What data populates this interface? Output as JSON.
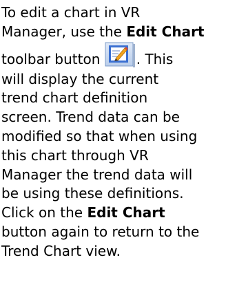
{
  "lines": [
    {
      "text": "To edit a chart in VR"
    },
    {
      "text": "Manager, use the ",
      "bold": "Edit Chart"
    },
    {
      "before": "toolbar button ",
      "after": ".  This"
    },
    {
      "text": "will display the current"
    },
    {
      "text": "trend chart definition"
    },
    {
      "text": "screen.  Trend data can be"
    },
    {
      "text": "modified so that when using"
    },
    {
      "text": "this chart through VR"
    },
    {
      "text": "Manager the trend data will"
    },
    {
      "text": "be using these definitions."
    },
    {
      "text": "Click on the ",
      "bold": "Edit Chart"
    },
    {
      "text": "button again to return to the"
    },
    {
      "text": "Trend Chart view."
    }
  ],
  "icon": {
    "name": "edit-chart-icon",
    "frame_color": "#3a6fd1",
    "pencil_color": "#f2a31b"
  }
}
